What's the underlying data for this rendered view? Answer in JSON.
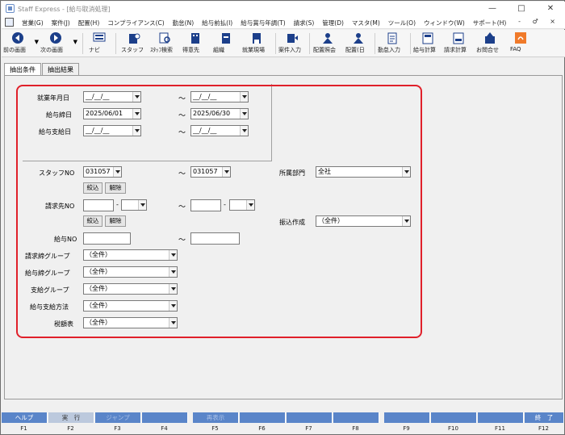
{
  "window": {
    "title": "Staff Express - [給与取消処理]",
    "controls": [
      "—",
      "□",
      "✕"
    ]
  },
  "menu": {
    "items": [
      "営業(G)",
      "案件(J)",
      "配置(H)",
      "コンプライアンス(C)",
      "勤怠(N)",
      "給与前払(I)",
      "給与賞与年調(T)",
      "請求(S)",
      "管理(D)",
      "マスタ(M)",
      "ツール(O)",
      "ウィンドウ(W)",
      "サポート(H)"
    ],
    "mdi_controls": "- ♂ ×"
  },
  "toolbar": {
    "prev": "前の画面",
    "next": "次の画面",
    "navi": "ナビ",
    "staff": "スタッフ",
    "staff_search": "ｽﾀｯﾌ検索",
    "client": "得意先",
    "org": "組織",
    "site": "就業現場",
    "case_entry": "案件入力",
    "assign_view": "配置照会",
    "assign_day": "配置(日",
    "attendance_entry": "勤怠入力",
    "pay_calc": "給与計算",
    "bill_calc": "請求計算",
    "inquiry": "お問合せ",
    "faq": "FAQ"
  },
  "tabs": [
    "抽出条件",
    "抽出結果"
  ],
  "form": {
    "work_month_label": "就業年月日",
    "work_month_from": "__/__/__",
    "work_month_to": "__/__/__",
    "pay_close_label": "給与締日",
    "pay_close_from": "2025/06/01",
    "pay_close_to": "2025/06/30",
    "pay_date_label": "給与支給日",
    "pay_date_from": "__/__/__",
    "pay_date_to": "__/__/__",
    "staff_no_label": "スタッフNO",
    "staff_no_from": "031057",
    "staff_no_to": "031057",
    "dept_label": "所属部門",
    "dept_value": "全社",
    "narrow_btn": "絞込",
    "clear_btn": "解除",
    "billing_label": "請求先NO",
    "billing_from_1": "",
    "billing_from_2": "",
    "billing_to_1": "",
    "billing_to_2": "",
    "transfer_label": "振込作成",
    "transfer_value": "（全件）",
    "pay_no_label": "給与NO",
    "pay_no_from": "",
    "pay_no_to": "",
    "bill_group_label": "請求締グループ",
    "bill_group_value": "（全件）",
    "pay_group_label": "給与締グループ",
    "pay_group_value": "（全件）",
    "support_group_label": "支給グループ",
    "support_group_value": "（全件）",
    "pay_method_label": "給与支給方法",
    "pay_method_value": "（全件）",
    "tax_table_label": "税額表",
    "tax_table_value": "（全件）",
    "tilde": "～",
    "dash": "-"
  },
  "fkeys": [
    {
      "label": "ヘルプ",
      "num": "F1"
    },
    {
      "label": "実　行",
      "num": "F2"
    },
    {
      "label": "ジャンプ",
      "num": "F3"
    },
    {
      "label": "",
      "num": "F4"
    },
    {
      "label": "再表示",
      "num": "F5"
    },
    {
      "label": "",
      "num": "F6"
    },
    {
      "label": "",
      "num": "F7"
    },
    {
      "label": "",
      "num": "F8"
    },
    {
      "label": "",
      "num": "F9"
    },
    {
      "label": "",
      "num": "F10"
    },
    {
      "label": "",
      "num": "F11"
    },
    {
      "label": "終　了",
      "num": "F12"
    }
  ]
}
